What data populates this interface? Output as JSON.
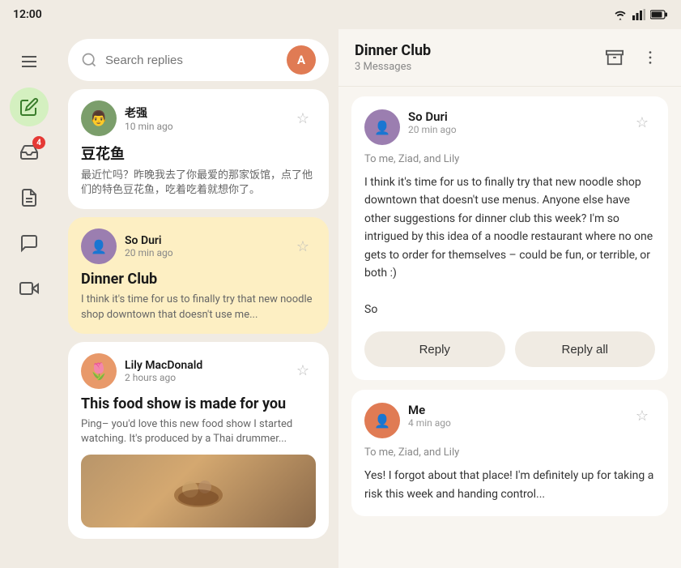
{
  "statusBar": {
    "time": "12:00",
    "icons": [
      "wifi",
      "signal",
      "battery"
    ]
  },
  "sidebar": {
    "items": [
      {
        "name": "menu",
        "icon": "menu",
        "active": false
      },
      {
        "name": "compose",
        "icon": "edit",
        "active": true
      },
      {
        "name": "inbox",
        "icon": "inbox",
        "active": false,
        "badge": "4"
      },
      {
        "name": "notes",
        "icon": "notes",
        "active": false
      },
      {
        "name": "chat",
        "icon": "chat",
        "active": false
      },
      {
        "name": "video",
        "icon": "video",
        "active": false
      }
    ]
  },
  "leftPanel": {
    "search": {
      "placeholder": "Search replies",
      "avatarInitial": "A"
    },
    "messages": [
      {
        "id": "msg1",
        "sender": "老强",
        "time": "10 min ago",
        "title": "豆花鱼",
        "preview": "最近忙吗？昨晚我去了你最爱的那家饭馆，点了他们的特色豆花鱼，吃着吃着就想你了。",
        "avatarColor": "av-laoquiang",
        "selected": false,
        "hasImage": false
      },
      {
        "id": "msg2",
        "sender": "So Duri",
        "time": "20 min ago",
        "title": "Dinner Club",
        "preview": "I think it's time for us to finally try that new noodle shop downtown that doesn't use me...",
        "avatarColor": "av-soduri",
        "selected": true,
        "hasImage": false
      },
      {
        "id": "msg3",
        "sender": "Lily MacDonald",
        "time": "2 hours ago",
        "title": "This food show is made for you",
        "preview": "Ping– you'd love this new food show I started watching. It's produced by a Thai drummer...",
        "avatarColor": "av-lily",
        "selected": false,
        "hasImage": true
      }
    ]
  },
  "rightPanel": {
    "threadTitle": "Dinner Club",
    "threadCount": "3 Messages",
    "emails": [
      {
        "id": "email1",
        "sender": "So Duri",
        "time": "20 min ago",
        "to": "To me, Ziad, and Lily",
        "body": "I think it's time for us to finally try that new noodle shop downtown that doesn't use menus. Anyone else have other suggestions for dinner club this week? I'm so intrigued by this idea of a noodle restaurant where no one gets to order for themselves – could be fun, or terrible, or both :)\n\nSo",
        "avatarColor": "av-soduri",
        "showActions": true,
        "replyLabel": "Reply",
        "replyAllLabel": "Reply all"
      },
      {
        "id": "email2",
        "sender": "Me",
        "time": "4 min ago",
        "to": "To me, Ziad, and Lily",
        "body": "Yes! I forgot about that place! I'm definitely up for taking a risk this week and handing control...",
        "avatarColor": "av-me",
        "showActions": false
      }
    ]
  }
}
